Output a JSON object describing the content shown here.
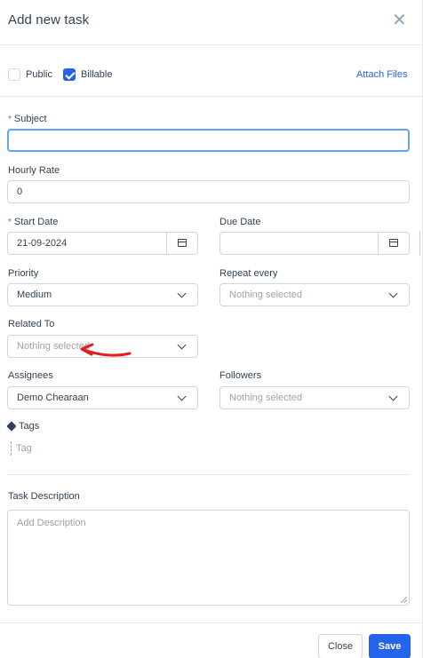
{
  "header": {
    "title": "Add new task",
    "close_glyph": "✕"
  },
  "checks": {
    "public_label": "Public",
    "public_checked": false,
    "billable_label": "Billable",
    "billable_checked": true,
    "attach_label": "Attach Files"
  },
  "fields": {
    "required_mark": "*",
    "subject": {
      "label": "Subject",
      "value": ""
    },
    "hourly_rate": {
      "label": "Hourly Rate",
      "value": "0"
    },
    "start_date": {
      "label": "Start Date",
      "value": "21-09-2024"
    },
    "due_date": {
      "label": "Due Date",
      "value": ""
    },
    "priority": {
      "label": "Priority",
      "value": "Medium"
    },
    "repeat_every": {
      "label": "Repeat every",
      "value": "Nothing selected"
    },
    "related_to": {
      "label": "Related To",
      "value": "Nothing selected"
    },
    "assignees": {
      "label": "Assignees",
      "value": "Demo Chearaan"
    },
    "followers": {
      "label": "Followers",
      "value": "Nothing selected"
    },
    "tags": {
      "label": "Tags",
      "placeholder": "Tag"
    },
    "description": {
      "label": "Task Description",
      "placeholder": "Add Description"
    }
  },
  "footer": {
    "close_label": "Close",
    "save_label": "Save"
  },
  "colors": {
    "accent": "#2563eb",
    "annotation_arrow": "#e11d1d"
  },
  "icons": [
    "close-icon",
    "checkbox-checked-icon",
    "calendar-icon",
    "chevron-down-icon",
    "tag-icon",
    "resize-handle-icon",
    "red-arrow-annotation"
  ]
}
